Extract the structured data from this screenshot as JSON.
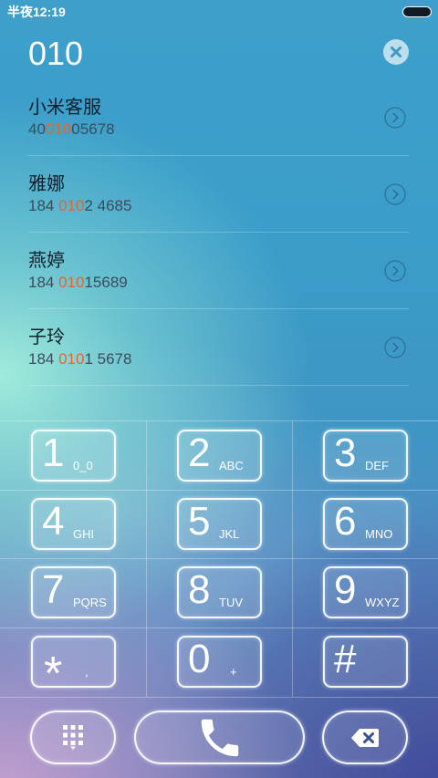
{
  "status_bar": {
    "time": "半夜12:19",
    "battery_icon": "battery-icon"
  },
  "dial_input": {
    "value": "010",
    "clear_icon": "clear-icon"
  },
  "contacts": [
    {
      "name": "小米客服",
      "number": {
        "before": "40",
        "match": "010",
        "after": "05678"
      }
    },
    {
      "name": "雅娜",
      "number": {
        "before": "184 ",
        "match": "010",
        "after": "2 4685"
      }
    },
    {
      "name": "燕婷",
      "number": {
        "before": "184 ",
        "match": "010",
        "after": "15689"
      }
    },
    {
      "name": "子玲",
      "number": {
        "before": "184 ",
        "match": "010",
        "after": "1 5678"
      }
    }
  ],
  "contact_action_icon": "chevron-right-icon",
  "keypad": {
    "keys": [
      {
        "digit": "1",
        "letters": "0_0"
      },
      {
        "digit": "2",
        "letters": "ABC"
      },
      {
        "digit": "3",
        "letters": "DEF"
      },
      {
        "digit": "4",
        "letters": "GHI"
      },
      {
        "digit": "5",
        "letters": "JKL"
      },
      {
        "digit": "6",
        "letters": "MNO"
      },
      {
        "digit": "7",
        "letters": "PQRS"
      },
      {
        "digit": "8",
        "letters": "TUV"
      },
      {
        "digit": "9",
        "letters": "WXYZ"
      },
      {
        "digit": "*",
        "letters": ","
      },
      {
        "digit": "0",
        "letters": "+"
      },
      {
        "digit": "#"
      }
    ]
  },
  "action_bar": {
    "dialpad_icon": "dialpad-icon",
    "call_icon": "phone-icon",
    "delete_icon": "backspace-icon"
  },
  "colors": {
    "match_highlight": "#e3662c",
    "name_text": "#13202c",
    "number_text": "#3a4c5b",
    "clear_x": "#3d98c2",
    "backspace_x": "#3a4f8f"
  }
}
